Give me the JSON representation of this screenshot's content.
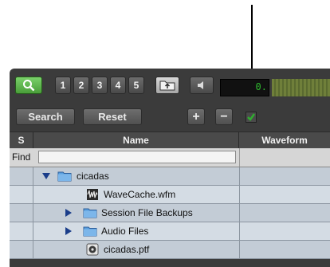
{
  "toolbar": {
    "track_buttons": [
      "1",
      "2",
      "3",
      "4",
      "5"
    ],
    "meter_readout": "0."
  },
  "actions": {
    "search_label": "Search",
    "reset_label": "Reset",
    "plus_label": "+",
    "minus_label": "−"
  },
  "columns": {
    "s": "S",
    "name": "Name",
    "waveform": "Waveform"
  },
  "find": {
    "label": "Find",
    "value": ""
  },
  "files": [
    {
      "name": "cicadas",
      "type": "folder",
      "expanded": true
    },
    {
      "name": "WaveCache.wfm",
      "type": "wfm-file"
    },
    {
      "name": "Session File Backups",
      "type": "folder",
      "expanded": false
    },
    {
      "name": "Audio Files",
      "type": "folder",
      "expanded": false
    },
    {
      "name": "cicadas.ptf",
      "type": "session-file"
    }
  ],
  "colors": {
    "panel_bg": "#3b3b3b",
    "search_toggle_green": "#5cb84a",
    "checkbox_check": "#2fae2f",
    "folder_blue": "#5aa0e0",
    "row_shade": "#c3ccd6",
    "row_light": "#d4dce4",
    "disclosure_triangle": "#1a3d8a"
  }
}
